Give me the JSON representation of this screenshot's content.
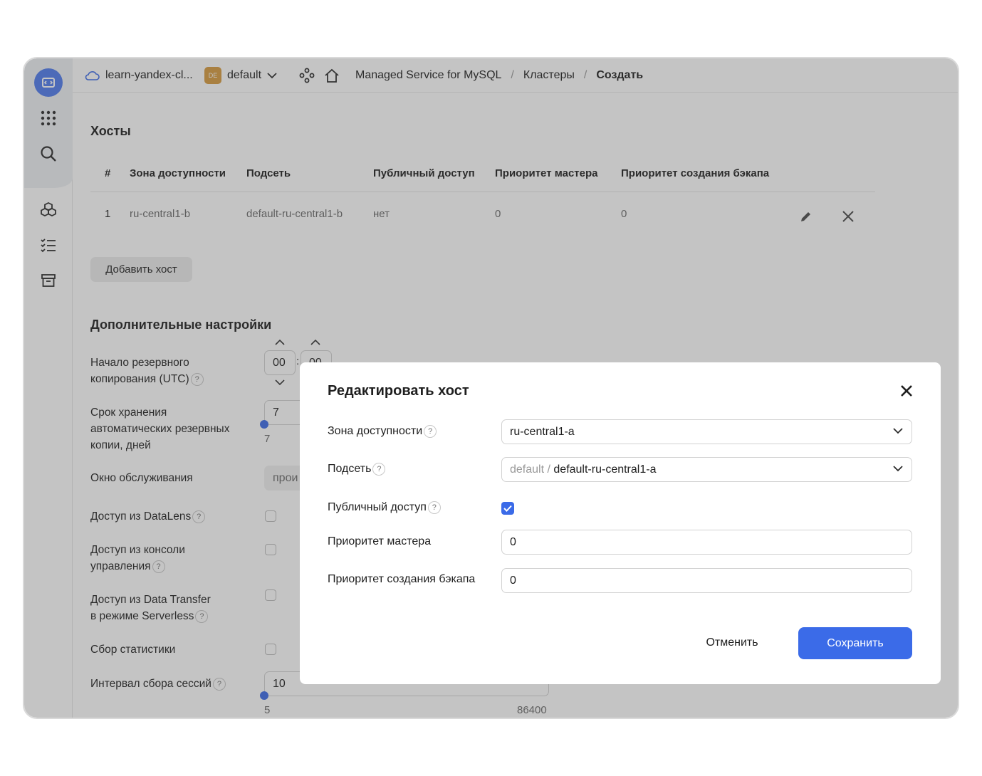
{
  "header": {
    "cloud_name": "learn-yandex-cl...",
    "folder_badge": "DE",
    "folder_name": "default",
    "breadcrumbs": [
      "Managed Service for MySQL",
      "Кластеры",
      "Создать"
    ],
    "separator": "/"
  },
  "hosts": {
    "title": "Хосты",
    "columns": [
      "#",
      "Зона доступности",
      "Подсеть",
      "Публичный доступ",
      "Приоритет мастера",
      "Приоритет создания бэкапа"
    ],
    "rows": [
      {
        "num": "1",
        "zone": "ru-central1-b",
        "subnet": "default-ru-central1-b",
        "public": "нет",
        "master_priority": "0",
        "backup_priority": "0"
      }
    ],
    "add_button": "Добавить хост"
  },
  "extra": {
    "title": "Дополнительные настройки",
    "backup_start_label_1": "Начало резервного",
    "backup_start_label_2": "копирования (UTC)",
    "backup_hours": "00",
    "backup_minutes": "00",
    "time_sep": ":",
    "retention_label_1": "Срок хранения",
    "retention_label_2": "автоматических резервных",
    "retention_label_3": "копии, дней",
    "retention_value": "7",
    "retention_min": "7",
    "maintenance_label": "Окно обслуживания",
    "maintenance_value": "прои",
    "datalens_label": "Доступ из DataLens",
    "console_label_1": "Доступ из консоли",
    "console_label_2": "управления",
    "transfer_label_1": "Доступ из Data Transfer",
    "transfer_label_2": "в режиме Serverless",
    "stats_label": "Сбор статистики",
    "sessions_label": "Интервал сбора сессий",
    "sessions_value": "10",
    "sessions_min": "5",
    "sessions_max": "86400",
    "help": "?"
  },
  "dialog": {
    "title": "Редактировать хост",
    "zone_label": "Зона доступности",
    "zone_value": "ru-central1-a",
    "subnet_label": "Подсеть",
    "subnet_prefix": "default",
    "subnet_sep": " / ",
    "subnet_value": "default-ru-central1-a",
    "public_label": "Публичный доступ",
    "public_checked": true,
    "master_label": "Приоритет мастера",
    "master_value": "0",
    "backup_label": "Приоритет создания бэкапа",
    "backup_value": "0",
    "cancel": "Отменить",
    "save": "Сохранить"
  },
  "colors": {
    "accent": "#3b6be8",
    "folder_badge": "#d79b3e"
  }
}
